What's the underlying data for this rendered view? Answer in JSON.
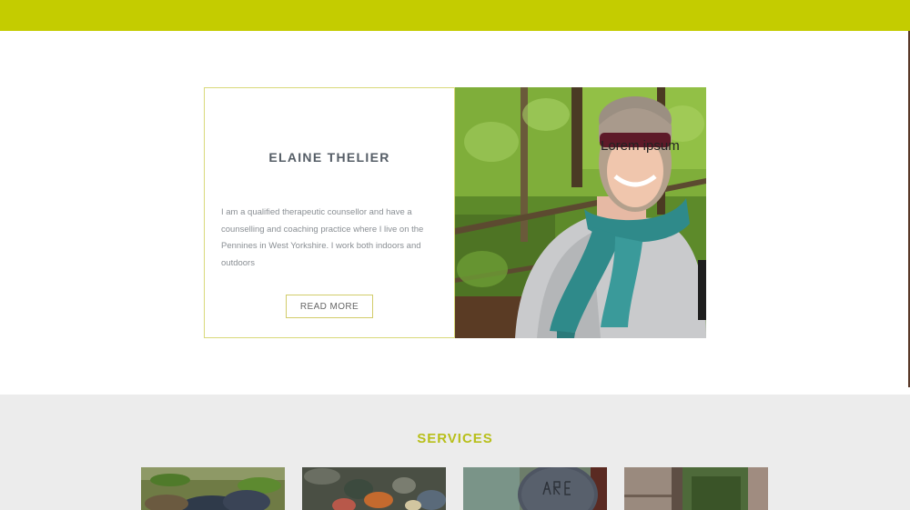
{
  "profile": {
    "name": "ELAINE THELIER",
    "bio": "I am a qualified therapeutic counsellor and have a counselling and coaching practice where I live on the Pennines in West Yorkshire. I work both indoors and outdoors",
    "read_more_label": "READ MORE",
    "photo_caption": "Lorem ipsum"
  },
  "services": {
    "title": "SERVICES",
    "cards": [
      {
        "name": "stones-on-moss"
      },
      {
        "name": "pebbles-in-water"
      },
      {
        "name": "carved-stone"
      },
      {
        "name": "stone-wall"
      }
    ]
  },
  "colors": {
    "accent": "#c4cc00",
    "card_border": "#d9d97a",
    "services_bg": "#ececec"
  }
}
